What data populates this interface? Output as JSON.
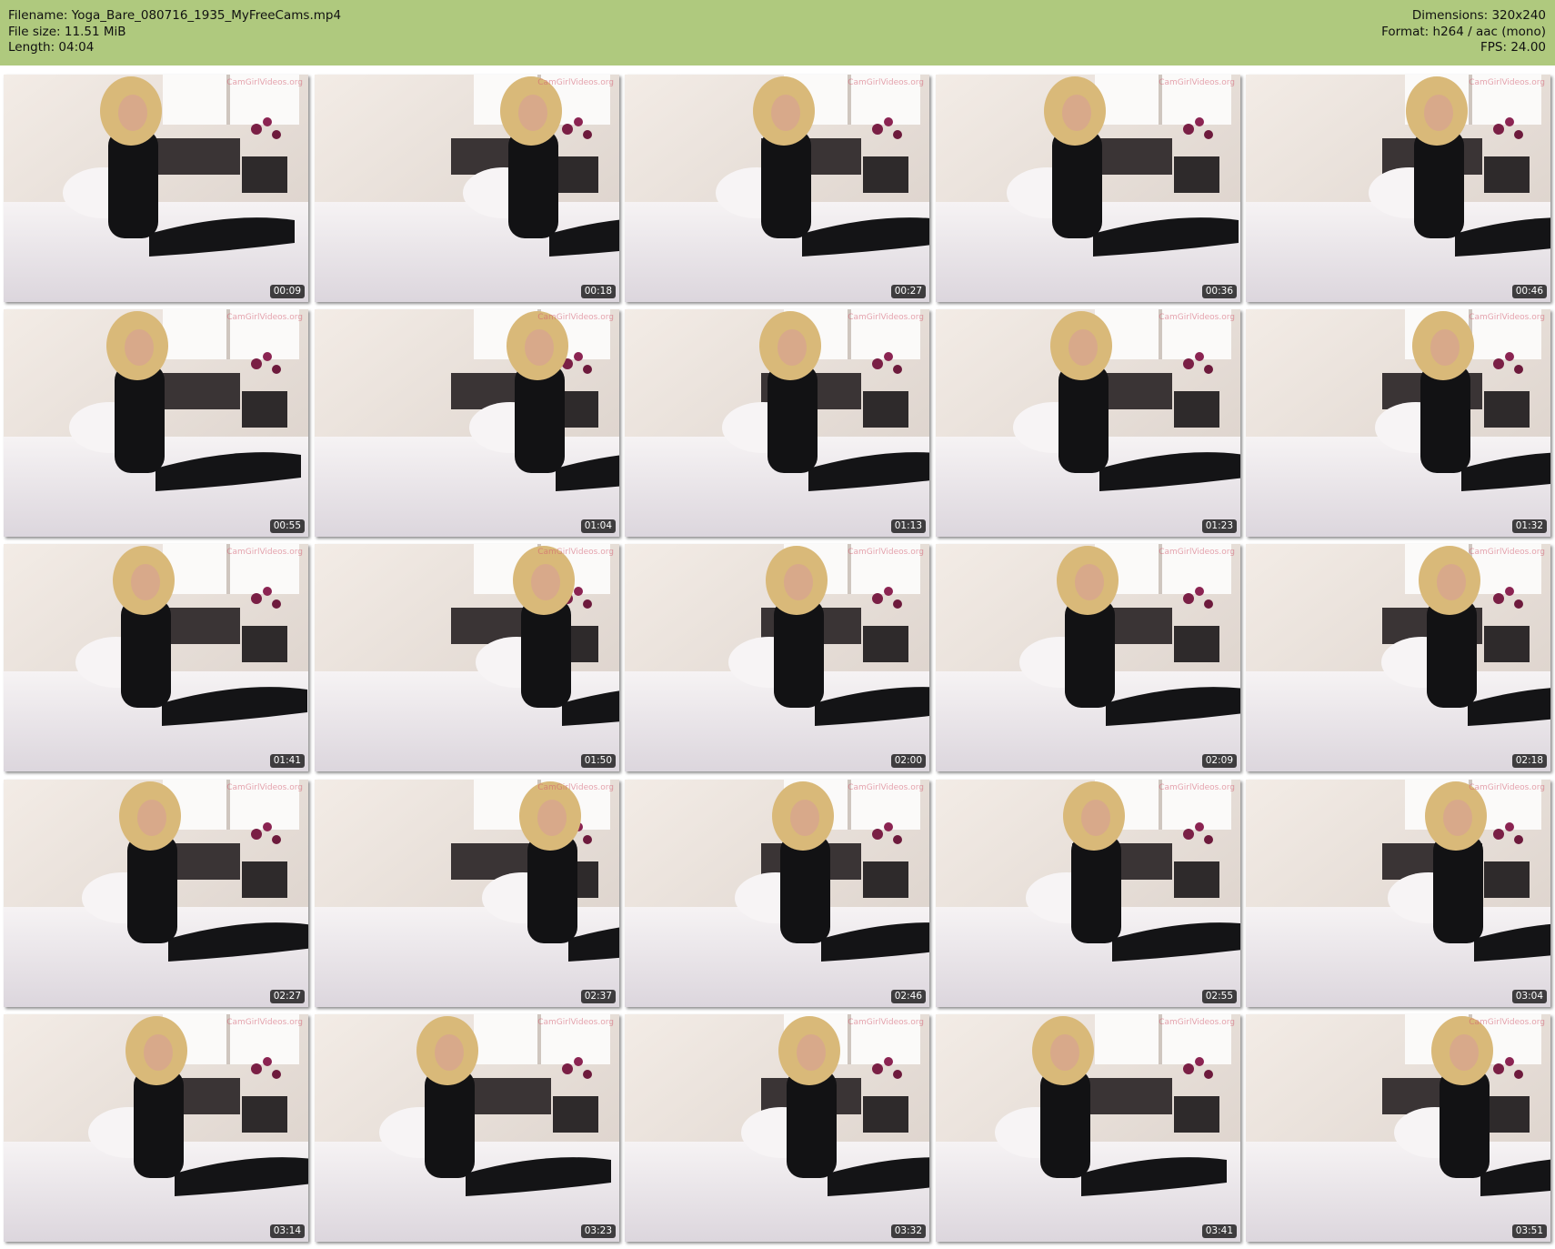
{
  "header": {
    "filename_label": "Filename:",
    "filename": "Yoga_Bare_080716_1935_MyFreeCams.mp4",
    "filesize_label": "File size:",
    "filesize": "11.51 MiB",
    "length_label": "Length:",
    "length": "04:04",
    "dimensions_label": "Dimensions:",
    "dimensions": "320x240",
    "format_label": "Format:",
    "format": "h264 / aac (mono)",
    "fps_label": "FPS:",
    "fps": "24.00"
  },
  "watermark": "CamGirlVideos.org",
  "colors": {
    "header_bg": "#afc97e",
    "timestamp_bg": "#000000",
    "timestamp_fg": "#ffffff"
  },
  "thumbnails": [
    {
      "timestamp": "00:09"
    },
    {
      "timestamp": "00:18"
    },
    {
      "timestamp": "00:27"
    },
    {
      "timestamp": "00:36"
    },
    {
      "timestamp": "00:46"
    },
    {
      "timestamp": "00:55"
    },
    {
      "timestamp": "01:04"
    },
    {
      "timestamp": "01:13"
    },
    {
      "timestamp": "01:23"
    },
    {
      "timestamp": "01:32"
    },
    {
      "timestamp": "01:41"
    },
    {
      "timestamp": "01:50"
    },
    {
      "timestamp": "02:00"
    },
    {
      "timestamp": "02:09"
    },
    {
      "timestamp": "02:18"
    },
    {
      "timestamp": "02:27"
    },
    {
      "timestamp": "02:37"
    },
    {
      "timestamp": "02:46"
    },
    {
      "timestamp": "02:55"
    },
    {
      "timestamp": "03:04"
    },
    {
      "timestamp": "03:14"
    },
    {
      "timestamp": "03:23"
    },
    {
      "timestamp": "03:32"
    },
    {
      "timestamp": "03:41"
    },
    {
      "timestamp": "03:51"
    }
  ]
}
